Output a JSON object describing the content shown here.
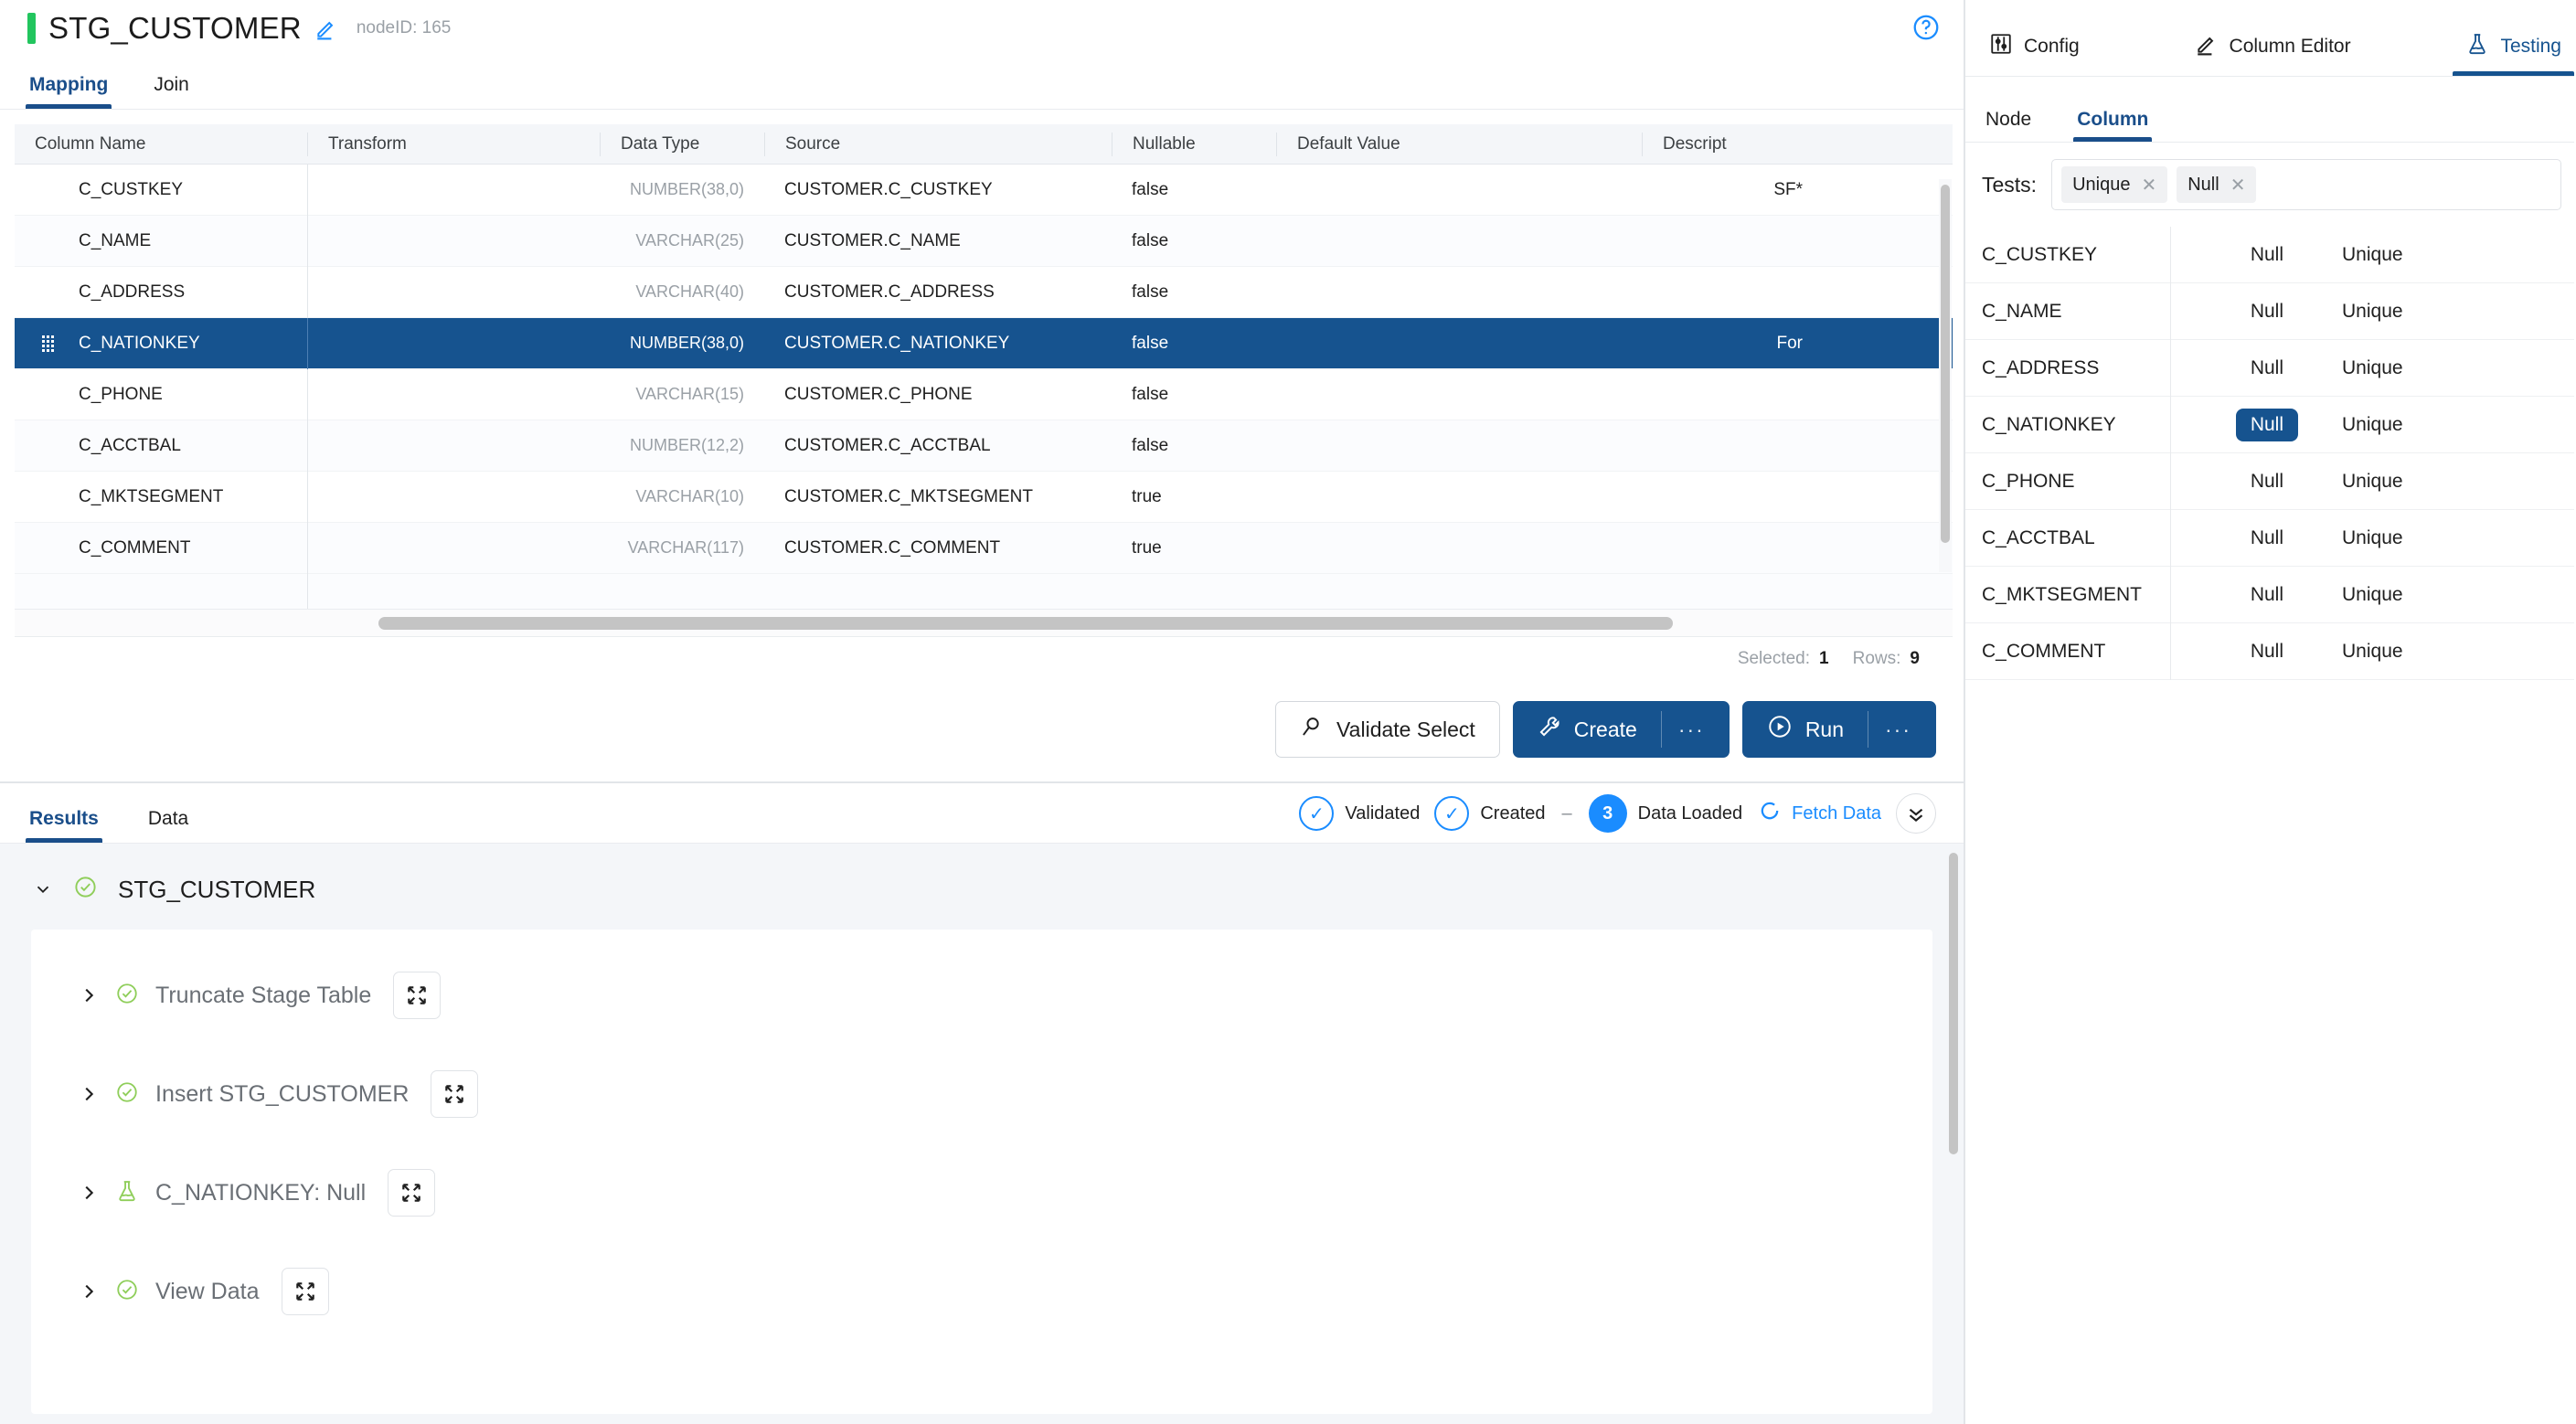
{
  "header": {
    "node_title": "STG_CUSTOMER",
    "node_id": "nodeID: 165",
    "edit_icon": "pencil-icon",
    "help_icon": "help-circle-icon"
  },
  "tabs": [
    {
      "label": "Mapping",
      "active": true
    },
    {
      "label": "Join",
      "active": false
    }
  ],
  "grid": {
    "columns": [
      "Column Name",
      "Transform",
      "Data Type",
      "Source",
      "Nullable",
      "Default Value",
      "Descript"
    ],
    "rows": [
      {
        "name": "C_CUSTKEY",
        "transform": "",
        "type": "NUMBER(38,0)",
        "source": "CUSTOMER.C_CUSTKEY",
        "nullable": "false",
        "default": "",
        "description": "SF*",
        "selected": false
      },
      {
        "name": "C_NAME",
        "transform": "",
        "type": "VARCHAR(25)",
        "source": "CUSTOMER.C_NAME",
        "nullable": "false",
        "default": "",
        "description": "",
        "selected": false
      },
      {
        "name": "C_ADDRESS",
        "transform": "",
        "type": "VARCHAR(40)",
        "source": "CUSTOMER.C_ADDRESS",
        "nullable": "false",
        "default": "",
        "description": "",
        "selected": false
      },
      {
        "name": "C_NATIONKEY",
        "transform": "",
        "type": "NUMBER(38,0)",
        "source": "CUSTOMER.C_NATIONKEY",
        "nullable": "false",
        "default": "",
        "description": "For",
        "selected": true
      },
      {
        "name": "C_PHONE",
        "transform": "",
        "type": "VARCHAR(15)",
        "source": "CUSTOMER.C_PHONE",
        "nullable": "false",
        "default": "",
        "description": "",
        "selected": false
      },
      {
        "name": "C_ACCTBAL",
        "transform": "",
        "type": "NUMBER(12,2)",
        "source": "CUSTOMER.C_ACCTBAL",
        "nullable": "false",
        "default": "",
        "description": "",
        "selected": false
      },
      {
        "name": "C_MKTSEGMENT",
        "transform": "",
        "type": "VARCHAR(10)",
        "source": "CUSTOMER.C_MKTSEGMENT",
        "nullable": "true",
        "default": "",
        "description": "",
        "selected": false
      },
      {
        "name": "C_COMMENT",
        "transform": "",
        "type": "VARCHAR(117)",
        "source": "CUSTOMER.C_COMMENT",
        "nullable": "true",
        "default": "",
        "description": "",
        "selected": false
      }
    ],
    "status": {
      "selected_label": "Selected:",
      "selected_count": "1",
      "rows_label": "Rows:",
      "rows_count": "9"
    }
  },
  "actions": {
    "validate_label": "Validate Select",
    "validate_icon": "magnifier-icon",
    "create_label": "Create",
    "create_icon": "wrench-icon",
    "create_more": "···",
    "run_label": "Run",
    "run_icon": "play-circle-icon",
    "run_more": "···"
  },
  "results": {
    "tabs": [
      {
        "label": "Results",
        "active": true
      },
      {
        "label": "Data",
        "active": false
      }
    ],
    "status": {
      "validated": "Validated",
      "created": "Created",
      "dash": "–",
      "data_loaded_count": "3",
      "data_loaded": "Data Loaded",
      "fetch_data": "Fetch Data",
      "check_glyph": "✓"
    },
    "root": {
      "label": "STG_CUSTOMER",
      "icon": "check-circle-icon",
      "expanded": true
    },
    "items": [
      {
        "label": "Truncate Stage Table",
        "icon": "check-circle-icon"
      },
      {
        "label": "Insert STG_CUSTOMER",
        "icon": "check-circle-icon"
      },
      {
        "label": "C_NATIONKEY: Null",
        "icon": "flask-icon"
      },
      {
        "label": "View Data",
        "icon": "check-circle-icon"
      }
    ]
  },
  "right_panel": {
    "tabs": [
      {
        "label": "Config",
        "icon": "sliders-icon",
        "active": false
      },
      {
        "label": "Column Editor",
        "icon": "pencil-icon",
        "active": false
      },
      {
        "label": "Testing",
        "icon": "flask-icon",
        "active": true
      }
    ],
    "sub_tabs": [
      {
        "label": "Node",
        "active": false
      },
      {
        "label": "Column",
        "active": true
      }
    ],
    "tests_label": "Tests:",
    "test_chips": [
      {
        "label": "Unique"
      },
      {
        "label": "Null"
      }
    ],
    "test_rows": [
      {
        "name": "C_CUSTKEY",
        "null": "Null",
        "unique": "Unique",
        "null_active": false
      },
      {
        "name": "C_NAME",
        "null": "Null",
        "unique": "Unique",
        "null_active": false
      },
      {
        "name": "C_ADDRESS",
        "null": "Null",
        "unique": "Unique",
        "null_active": false
      },
      {
        "name": "C_NATIONKEY",
        "null": "Null",
        "unique": "Unique",
        "null_active": true
      },
      {
        "name": "C_PHONE",
        "null": "Null",
        "unique": "Unique",
        "null_active": false
      },
      {
        "name": "C_ACCTBAL",
        "null": "Null",
        "unique": "Unique",
        "null_active": false
      },
      {
        "name": "C_MKTSEGMENT",
        "null": "Null",
        "unique": "Unique",
        "null_active": false
      },
      {
        "name": "C_COMMENT",
        "null": "Null",
        "unique": "Unique",
        "null_active": false
      }
    ]
  },
  "colors": {
    "accent": "#16538f",
    "link": "#1a8cff",
    "green": "#22c55e",
    "green_light": "#8fce5a"
  }
}
